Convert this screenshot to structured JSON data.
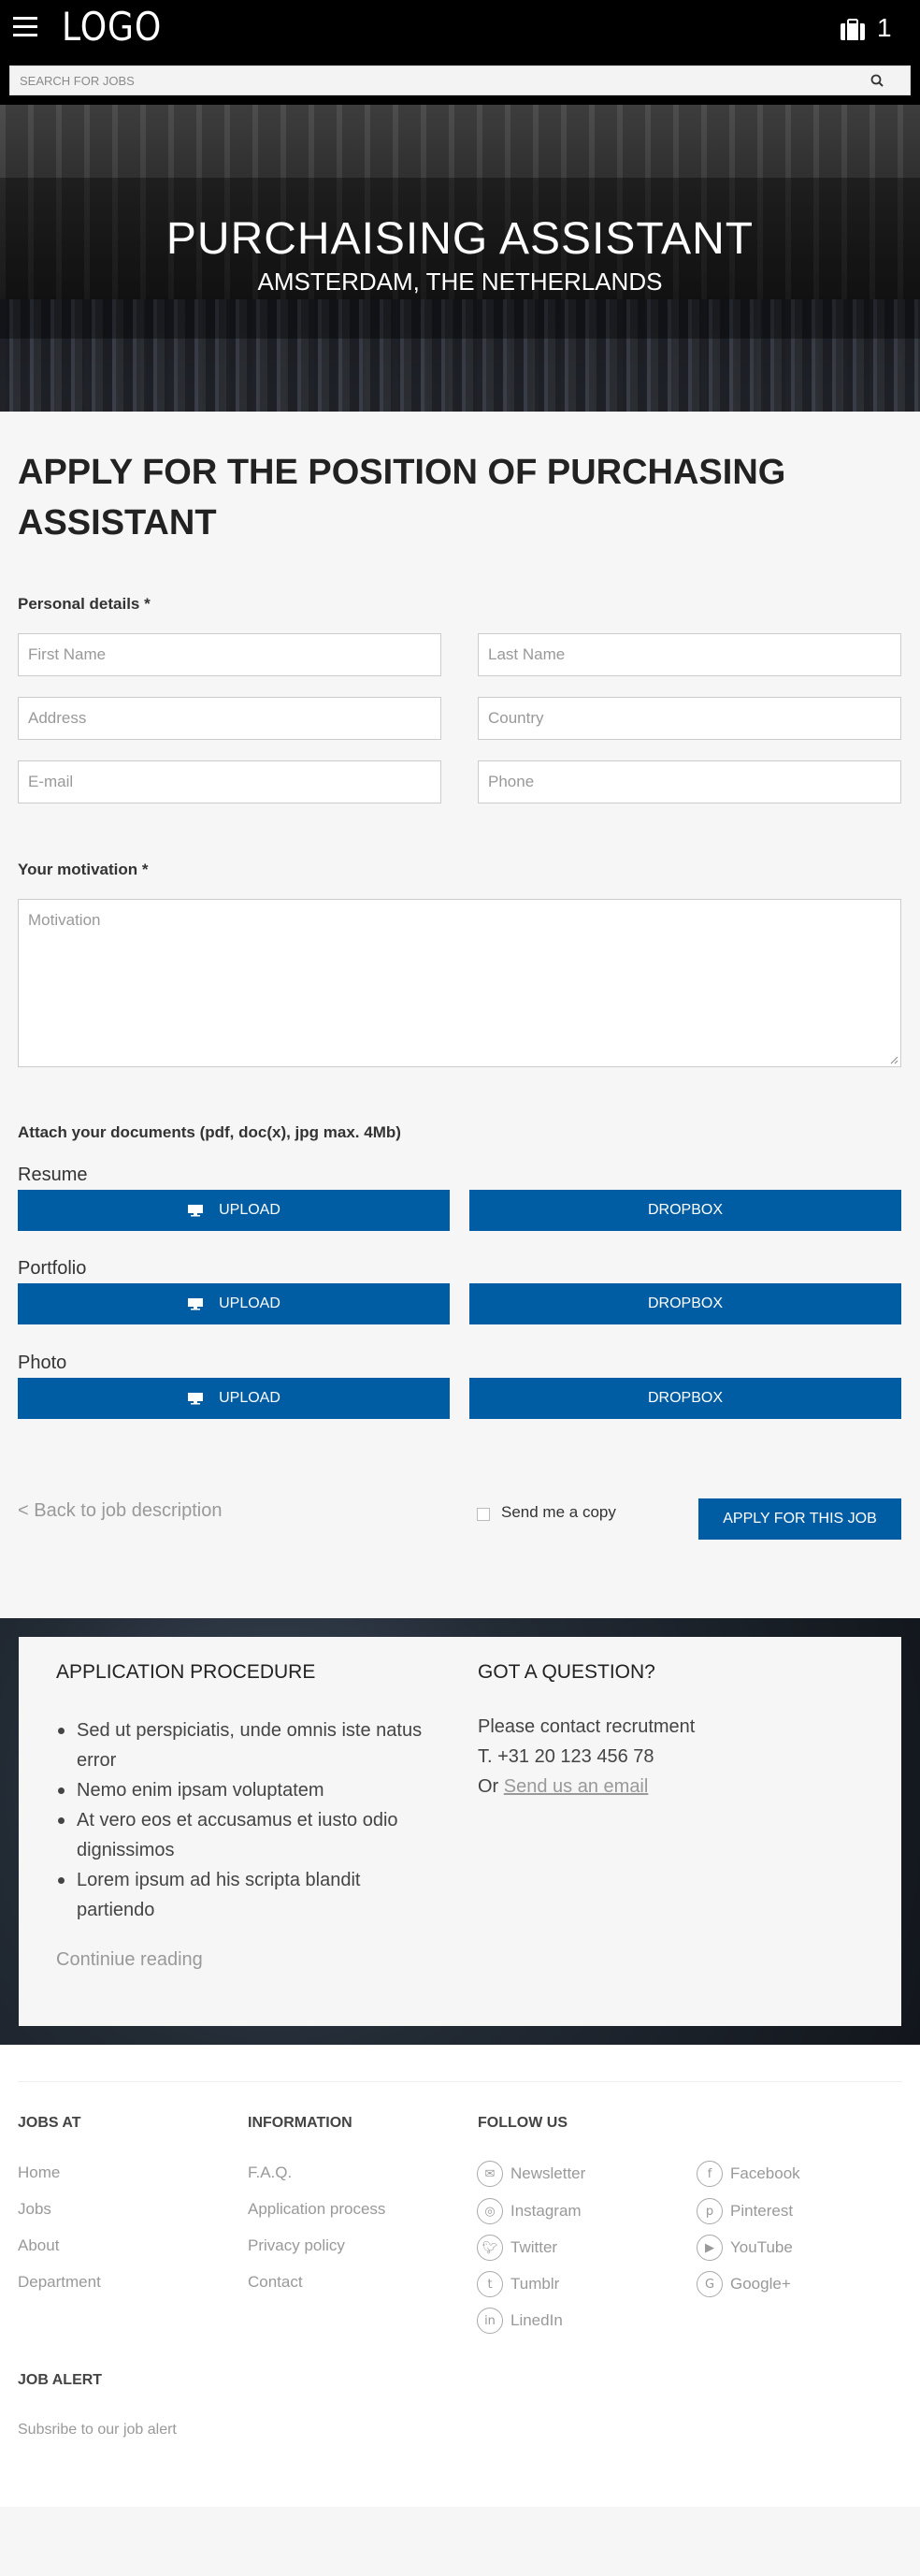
{
  "header": {
    "logo": "LOGO",
    "bag_count": "1",
    "search_placeholder": "SEARCH FOR JOBS"
  },
  "hero": {
    "title": "PURCHAISING ASSISTANT",
    "subtitle": "AMSTERDAM, THE NETHERLANDS"
  },
  "apply": {
    "title": "APPLY FOR THE POSITION OF PURCHASING ASSISTANT",
    "personal_label": "Personal details *",
    "placeholders": {
      "first_name": "First Name",
      "last_name": "Last Name",
      "address": "Address",
      "country": "Country",
      "email": "E-mail",
      "phone": "Phone",
      "motivation": "Motivation"
    },
    "motivation_label": "Your motivation *",
    "attach_label": "Attach your documents (pdf, doc(x), jpg max. 4Mb)",
    "documents": [
      {
        "label": "Resume",
        "upload": "UPLOAD",
        "dropbox": "DROPBOX"
      },
      {
        "label": "Portfolio",
        "upload": "UPLOAD",
        "dropbox": "DROPBOX"
      },
      {
        "label": "Photo",
        "upload": "UPLOAD",
        "dropbox": "DROPBOX"
      }
    ],
    "back_link": "< Back to job description",
    "send_copy": "Send me a copy",
    "apply_button": "APPLY FOR THIS JOB"
  },
  "info": {
    "procedure_title": "APPLICATION PROCEDURE",
    "procedure_items": [
      "Sed ut perspiciatis, unde omnis iste natus error",
      "Nemo enim ipsam voluptatem",
      "At vero eos et accusamus et iusto odio dignissimos",
      "Lorem ipsum ad his scripta blandit partiendo"
    ],
    "continue": "Continiue reading",
    "question_title": "GOT A QUESTION?",
    "contact_line1": "Please contact recrutment",
    "contact_line2": "T. +31 20 123 456 78",
    "contact_or": "Or ",
    "contact_email_link": "Send us an email"
  },
  "footer": {
    "jobs_at": {
      "title": "JOBS AT",
      "links": [
        "Home",
        "Jobs",
        "About",
        "Department"
      ]
    },
    "information": {
      "title": "INFORMATION",
      "links": [
        "F.A.Q.",
        "Application process",
        "Privacy policy",
        "Contact"
      ]
    },
    "follow_us": {
      "title": "FOLLOW US",
      "items": [
        {
          "label": "Newsletter",
          "icon": "envelope-icon"
        },
        {
          "label": "Facebook",
          "icon": "facebook-icon"
        },
        {
          "label": "Instagram",
          "icon": "instagram-icon"
        },
        {
          "label": "Pinterest",
          "icon": "pinterest-icon"
        },
        {
          "label": "Twitter",
          "icon": "twitter-icon"
        },
        {
          "label": "YouTube",
          "icon": "youtube-icon"
        },
        {
          "label": "Tumblr",
          "icon": "tumblr-icon"
        },
        {
          "label": "Google+",
          "icon": "google-plus-icon"
        },
        {
          "label": "LinedIn",
          "icon": "linkedin-icon"
        }
      ]
    },
    "job_alert": {
      "title": "JOB ALERT",
      "link": "Subsribe to our job alert"
    }
  },
  "colors": {
    "primary": "#005ca3",
    "header_bg": "#000000",
    "page_bg": "#f6f6f6"
  }
}
